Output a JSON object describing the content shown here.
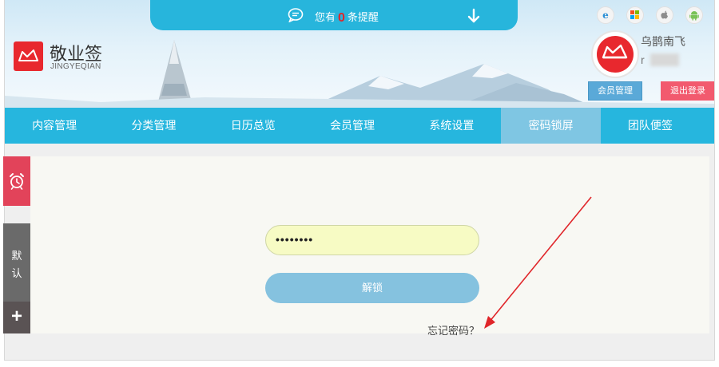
{
  "notice": {
    "prefix": "您有",
    "count": "0",
    "suffix": "条提醒"
  },
  "brand": {
    "name": "敬业签",
    "subtitle": "JINGYEQIAN"
  },
  "os_icons": [
    "ie-icon",
    "windows-icon",
    "apple-icon",
    "android-icon"
  ],
  "user": {
    "name": "乌鹊南飞",
    "id_prefix": "r"
  },
  "header_buttons": {
    "member": "会员管理",
    "logout": "退出登录"
  },
  "nav": {
    "items": [
      "内容管理",
      "分类管理",
      "日历总览",
      "会员管理",
      "系统设置",
      "密码锁屏",
      "团队便签"
    ],
    "active": "密码锁屏"
  },
  "sidebar": {
    "default_label": "默认",
    "add_label": "+"
  },
  "lock": {
    "password_value": "••••••••",
    "unlock_label": "解锁",
    "forgot_label": "忘记密码？"
  },
  "colors": {
    "nav_bg": "#26b6de",
    "nav_active": "#7fc6e3",
    "brand_red": "#e8282e",
    "logout_bg": "#f25a6e",
    "annotation_arrow": "#e0262a"
  }
}
